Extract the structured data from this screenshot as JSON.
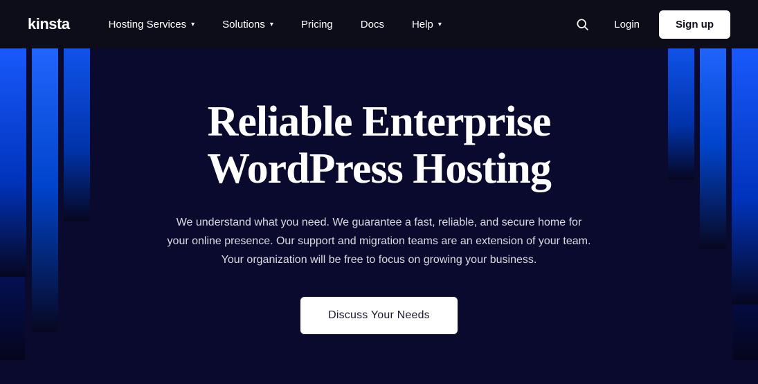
{
  "brand": {
    "logo_text": "kinsta"
  },
  "nav": {
    "links": [
      {
        "label": "Hosting Services",
        "id": "hosting-services"
      },
      {
        "label": "Solutions",
        "id": "solutions"
      },
      {
        "label": "Pricing",
        "id": "pricing"
      },
      {
        "label": "Docs",
        "id": "docs"
      },
      {
        "label": "Help",
        "id": "help"
      }
    ],
    "login_label": "Login",
    "signup_label": "Sign up",
    "search_aria": "Search"
  },
  "hero": {
    "title_line1": "Reliable Enterprise",
    "title_line2": "WordPress Hosting",
    "subtitle": "We understand what you need. We guarantee a fast, reliable, and secure home for your online presence. Our support and migration teams are an extension of your team. Your organization will be free to focus on growing your business.",
    "cta_label": "Discuss Your Needs"
  }
}
